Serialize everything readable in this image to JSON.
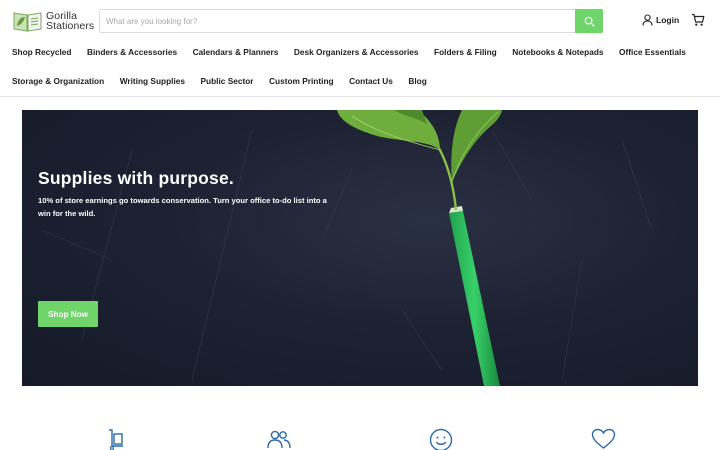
{
  "brand": {
    "name_line1": "Gorilla",
    "name_line2": "Stationers"
  },
  "search": {
    "placeholder": "What are you looking for?",
    "value": ""
  },
  "header": {
    "login_label": "Login"
  },
  "nav": {
    "row1": [
      "Shop Recycled",
      "Binders & Accessories",
      "Calendars & Planners",
      "Desk Organizers & Accessories",
      "Folders & Filing",
      "Notebooks & Notepads",
      "Office Essentials"
    ],
    "row2": [
      "Storage & Organization",
      "Writing Supplies",
      "Public Sector",
      "Custom Printing",
      "Contact Us",
      "Blog"
    ]
  },
  "hero": {
    "title": "Supplies with purpose.",
    "subtitle": "10% of store earnings go towards conservation. Turn your office to-do list into a win for the wild.",
    "button_label": "Shop Now"
  },
  "features": {
    "icons": [
      "hand-truck-icon",
      "users-icon",
      "smile-icon",
      "heart-icon"
    ]
  },
  "colors": {
    "accent": "#6fd56b",
    "icon_blue": "#2b6ca8",
    "hero_bg": "#1d2233"
  }
}
